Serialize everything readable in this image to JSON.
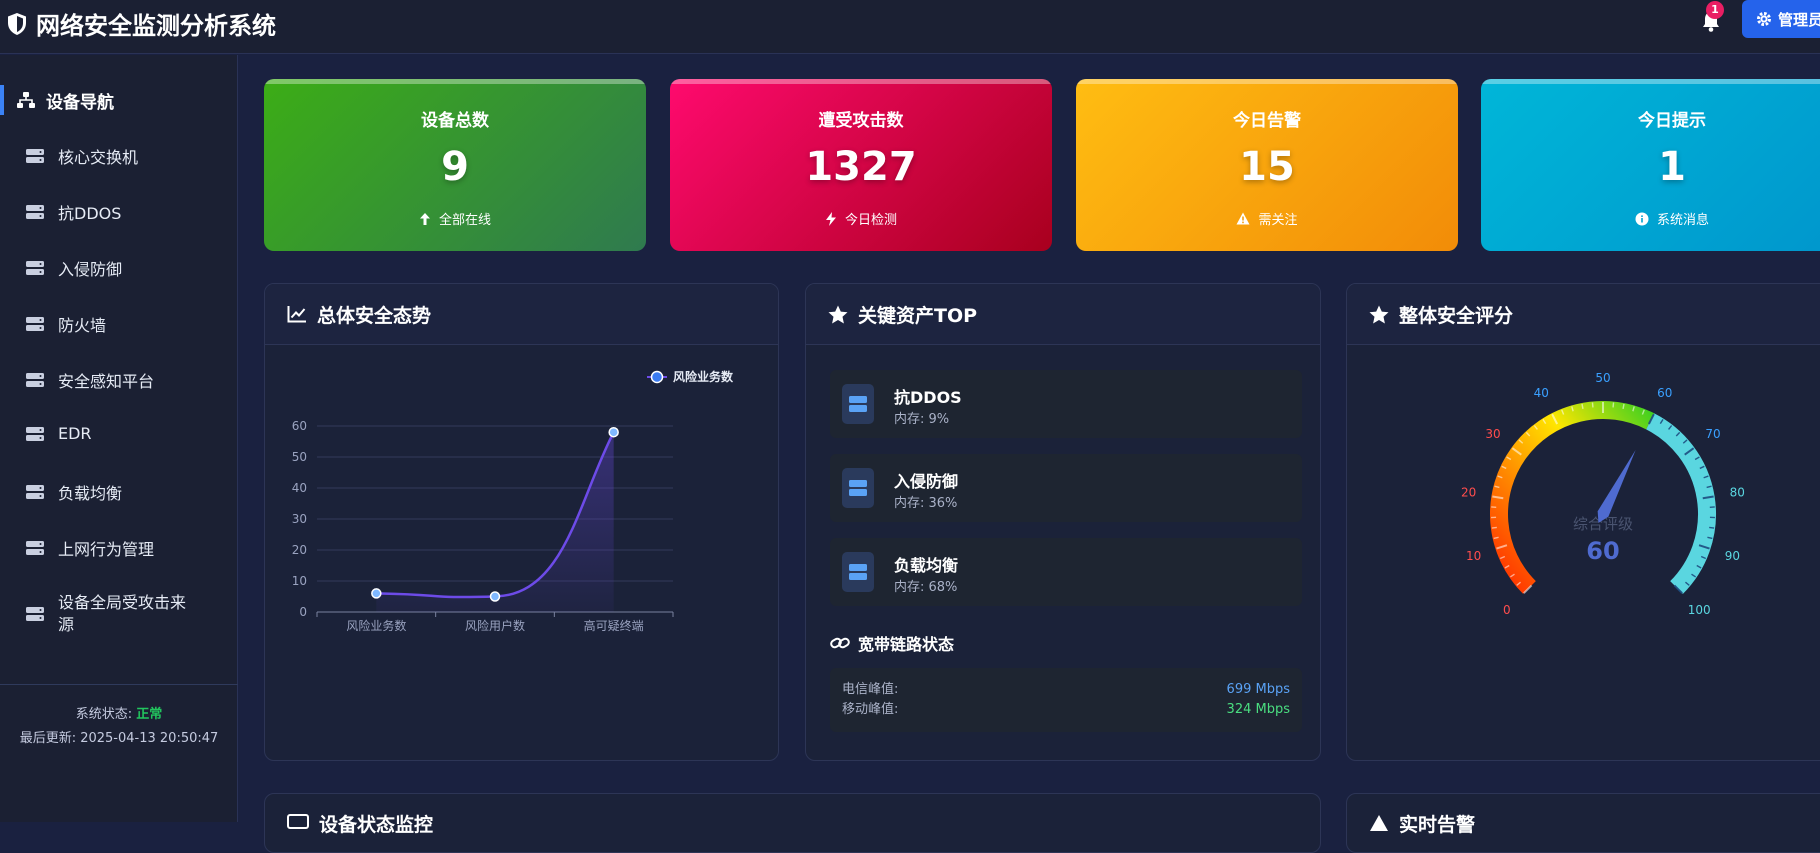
{
  "app": {
    "title": "网络安全监测分析系统",
    "notify_count": "1",
    "admin_label": "管理员"
  },
  "sidebar": {
    "title": "设备导航",
    "items": [
      {
        "label": "核心交换机"
      },
      {
        "label": "抗DDOS"
      },
      {
        "label": "入侵防御"
      },
      {
        "label": "防火墙"
      },
      {
        "label": "安全感知平台"
      },
      {
        "label": "EDR"
      },
      {
        "label": "负载均衡"
      },
      {
        "label": "上网行为管理"
      },
      {
        "label": "设备全局受攻击来源"
      }
    ],
    "status_label": "系统状态:",
    "status_value": "正常",
    "updated_label": "最后更新:",
    "updated_value": "2025-04-13 20:50:47"
  },
  "stats": [
    {
      "title": "设备总数",
      "value": "9",
      "sub": "全部在线",
      "icon": "arrow-up-icon",
      "gradient": [
        "#3cad16",
        "#2f7a4f"
      ]
    },
    {
      "title": "遭受攻击数",
      "value": "1327",
      "sub": "今日检测",
      "icon": "bolt-icon",
      "gradient": [
        "#ff0a6e",
        "#a8001e"
      ]
    },
    {
      "title": "今日告警",
      "value": "15",
      "sub": "需关注",
      "icon": "warning-icon",
      "gradient": [
        "#ffbd12",
        "#f28c08"
      ]
    },
    {
      "title": "今日提示",
      "value": "1",
      "sub": "系统消息",
      "icon": "info-icon",
      "gradient": [
        "#00b6d8",
        "#0095cc"
      ]
    }
  ],
  "panels": {
    "trend": {
      "title": "总体安全态势"
    },
    "assets": {
      "title": "关键资产TOP",
      "items": [
        {
          "name": "抗DDOS",
          "memory": "内存: 9%"
        },
        {
          "name": "入侵防御",
          "memory": "内存: 36%"
        },
        {
          "name": "负载均衡",
          "memory": "内存: 68%"
        }
      ],
      "link_title": "宽带链路状态",
      "links": [
        {
          "label": "电信峰值:",
          "value": "699 Mbps",
          "color": "#5aa2f5"
        },
        {
          "label": "移动峰值:",
          "value": "324 Mbps",
          "color": "#4ade80"
        }
      ]
    },
    "score": {
      "title": "整体安全评分",
      "gauge_label": "综合评级",
      "gauge_value": 60,
      "ticks": [
        "0",
        "10",
        "20",
        "30",
        "40",
        "50",
        "60",
        "70",
        "80",
        "90",
        "100"
      ]
    }
  },
  "bottom": {
    "device_title": "设备状态监控",
    "alert_title": "实时告警"
  },
  "chart_data": {
    "type": "line",
    "categories": [
      "风险业务数",
      "风险用户数",
      "高可疑终端"
    ],
    "series": [
      {
        "name": "风险业务数",
        "values": [
          6,
          5,
          58
        ]
      }
    ],
    "ylim": [
      0,
      60
    ],
    "yticks": [
      0,
      10,
      20,
      30,
      40,
      50,
      60
    ],
    "legend": "top-right",
    "grid": true,
    "color": "#6d4be8"
  }
}
